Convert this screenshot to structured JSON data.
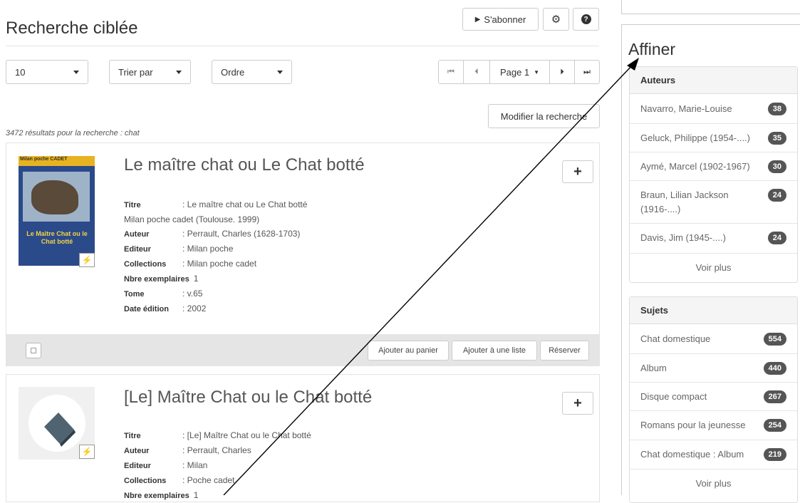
{
  "header": {
    "page_title": "Recherche ciblée",
    "subscribe_label": "S'abonner"
  },
  "toolbar": {
    "per_page": "10",
    "sort_by": "Trier par",
    "order": "Ordre",
    "page_label": "Page 1",
    "modify_search": "Modifier la recherche"
  },
  "results_summary": "3472 résultats pour la recherche : chat",
  "results": [
    {
      "title": "Le maître chat ou Le Chat botté",
      "fields": [
        {
          "label": "Titre",
          "value": ": Le maître chat ou Le Chat botté"
        },
        {
          "label": "",
          "value": "Milan poche cadet (Toulouse. 1999)"
        },
        {
          "label": "Auteur",
          "value": ": Perrault, Charles (1628-1703)"
        },
        {
          "label": "Editeur",
          "value": ": Milan poche"
        },
        {
          "label": "Collections",
          "value": ": Milan poche cadet"
        },
        {
          "label": "Nbre exemplaires",
          "value": "1"
        },
        {
          "label": "Tome",
          "value": ": v.65"
        },
        {
          "label": "Date édition",
          "value": ": 2002"
        }
      ],
      "cover_text_top": "Milan poche CADET",
      "cover_text_main": "Le Maître Chat ou le Chat botté",
      "actions": {
        "cart": "Ajouter au panier",
        "list": "Ajouter à une liste",
        "reserve": "Réserver"
      }
    },
    {
      "title": "[Le] Maître Chat ou le Chat botté",
      "fields": [
        {
          "label": "Titre",
          "value": ": [Le] Maître Chat ou le Chat botté"
        },
        {
          "label": "Auteur",
          "value": ": Perrault, Charles"
        },
        {
          "label": "Editeur",
          "value": ": Milan"
        },
        {
          "label": "Collections",
          "value": ": Poche cadet"
        },
        {
          "label": "Nbre exemplaires",
          "value": "1"
        }
      ]
    }
  ],
  "sidebar": {
    "title": "Affiner",
    "facets": [
      {
        "heading": "Auteurs",
        "items": [
          {
            "label": "Navarro, Marie-Louise",
            "count": "38"
          },
          {
            "label": "Geluck, Philippe (1954-....)",
            "count": "35"
          },
          {
            "label": "Aymé, Marcel (1902-1967)",
            "count": "30"
          },
          {
            "label": "Braun, Lilian Jackson (1916-....)",
            "count": "24"
          },
          {
            "label": "Davis, Jim (1945-....)",
            "count": "24"
          }
        ],
        "more": "Voir plus"
      },
      {
        "heading": "Sujets",
        "items": [
          {
            "label": "Chat domestique",
            "count": "554"
          },
          {
            "label": "Album",
            "count": "440"
          },
          {
            "label": "Disque compact",
            "count": "267"
          },
          {
            "label": "Romans pour la jeunesse",
            "count": "254"
          },
          {
            "label": "Chat domestique : Album",
            "count": "219"
          }
        ],
        "more": "Voir plus"
      }
    ]
  },
  "colors": {
    "annotation_line": "#000000",
    "badge": "#555555",
    "footer_bar": "#e5e5e5",
    "cover_blue": "#2b4a8a"
  }
}
